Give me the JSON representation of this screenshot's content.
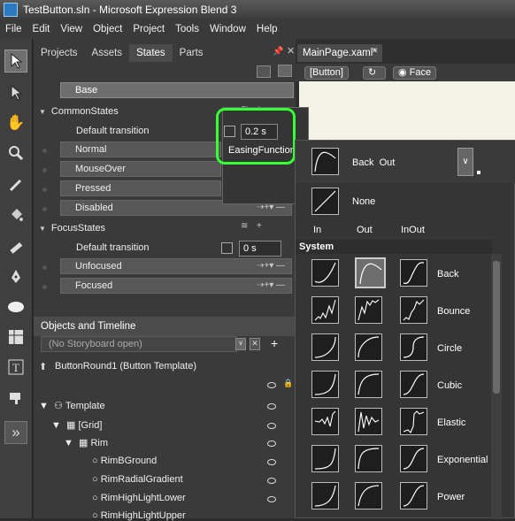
{
  "window": {
    "title": "TestButton.sln - Microsoft Expression Blend 3"
  },
  "menu": [
    "File",
    "Edit",
    "View",
    "Object",
    "Project",
    "Tools",
    "Window",
    "Help"
  ],
  "tools": [
    "selection-arrow",
    "direct-select",
    "pan",
    "zoom",
    "eyedropper",
    "paint-bucket",
    "brush",
    "pen",
    "ellipse",
    "grid",
    "text",
    "asset",
    "more"
  ],
  "left_tabs": [
    "Projects",
    "Assets",
    "States",
    "Parts"
  ],
  "states": {
    "base": "Base",
    "groups": [
      {
        "name": "CommonStates",
        "transition_label": "Default transition",
        "transition_value": "0.2 s",
        "items": [
          "Normal",
          "MouseOver",
          "Pressed",
          "Disabled"
        ]
      },
      {
        "name": "FocusStates",
        "transition_label": "Default transition",
        "transition_value": "0 s",
        "items": [
          "Unfocused",
          "Focused"
        ]
      }
    ]
  },
  "easing_popup": {
    "label": "EasingFunction"
  },
  "objects": {
    "tab": "Objects and Timeline",
    "storyboard": "(No Storyboard open)",
    "add_button": "+",
    "scope": "ButtonRound1 (Button Template)",
    "tree": [
      "Template",
      "[Grid]",
      "Rim",
      "RimBGround",
      "RimRadialGradient",
      "RimHighLightLower",
      "RimHighLightUpper"
    ]
  },
  "document": {
    "tab": "MainPage.xaml*",
    "breadcrumbs": [
      "[Button]",
      "Face"
    ]
  },
  "easing": {
    "current": "Back",
    "current_mode": "Out",
    "none_label": "None",
    "columns": [
      "In",
      "Out",
      "InOut"
    ],
    "section": "System",
    "functions": [
      "Back",
      "Bounce",
      "Circle",
      "Cubic",
      "Elastic",
      "Exponential",
      "Power"
    ]
  },
  "colors": {
    "highlight": "#33ff33",
    "artboard": "#f4f4e6"
  }
}
